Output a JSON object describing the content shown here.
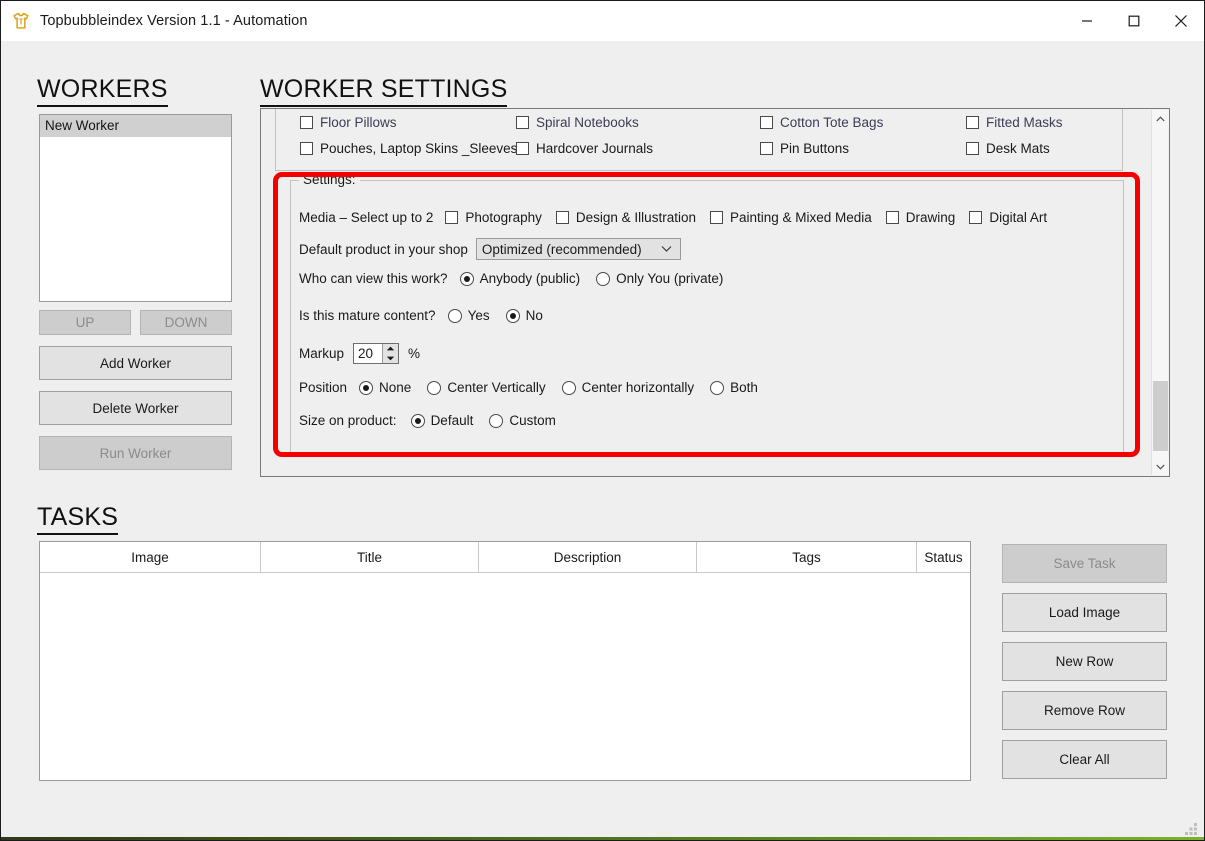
{
  "window": {
    "title": "Topbubbleindex Version 1.1 - Automation",
    "app_icon": "tshirt-icon",
    "accent_color": "#d9a520",
    "controls": {
      "minimize": "minimize-icon",
      "maximize": "maximize-icon",
      "close": "close-icon"
    }
  },
  "workers": {
    "heading": "WORKERS",
    "list": [
      {
        "label": "New Worker",
        "selected": true
      }
    ],
    "buttons": {
      "up": "UP",
      "down": "DOWN",
      "add": "Add Worker",
      "delete": "Delete Worker",
      "run": "Run Worker"
    },
    "disabled": [
      "UP",
      "DOWN",
      "Run Worker"
    ]
  },
  "worker_settings": {
    "heading": "WORKER SETTINGS",
    "products": {
      "clipped_row": [
        "Floor Pillows",
        "Spiral Notebooks",
        "Cotton Tote Bags",
        "Fitted Masks"
      ],
      "visible_row": [
        {
          "label": "Pouches, Laptop Skins _Sleeves",
          "checked": false
        },
        {
          "label": "Hardcover Journals",
          "checked": false
        },
        {
          "label": "Pin Buttons",
          "checked": false
        },
        {
          "label": "Desk Mats",
          "checked": false
        }
      ]
    },
    "settings_group": {
      "legend": "Settings:",
      "media": {
        "label": "Media – Select up to 2",
        "options": [
          {
            "label": "Photography",
            "checked": false
          },
          {
            "label": "Design & Illustration",
            "checked": false
          },
          {
            "label": "Painting & Mixed Media",
            "checked": false
          },
          {
            "label": "Drawing",
            "checked": false
          },
          {
            "label": "Digital Art",
            "checked": false
          }
        ]
      },
      "default_product": {
        "label": "Default product in your shop",
        "value": "Optimized (recommended)",
        "chevron": "chevron-down-icon"
      },
      "visibility": {
        "label": "Who can view this work?",
        "options": [
          {
            "label": "Anybody (public)",
            "checked": true
          },
          {
            "label": "Only You (private)",
            "checked": false
          }
        ]
      },
      "mature": {
        "label": "Is this mature content?",
        "options": [
          {
            "label": "Yes",
            "checked": false
          },
          {
            "label": "No",
            "checked": true
          }
        ]
      },
      "markup": {
        "label": "Markup",
        "value": "20",
        "unit": "%"
      },
      "position": {
        "label": "Position",
        "options": [
          {
            "label": "None",
            "checked": true
          },
          {
            "label": "Center Vertically",
            "checked": false
          },
          {
            "label": "Center horizontally",
            "checked": false
          },
          {
            "label": "Both",
            "checked": false
          }
        ]
      },
      "size_on_product": {
        "label": "Size on product:",
        "options": [
          {
            "label": "Default",
            "checked": true
          },
          {
            "label": "Custom",
            "checked": false
          }
        ]
      }
    },
    "scrollbar": {
      "up_arrow": "chevron-up-icon",
      "down_arrow": "chevron-down-icon"
    },
    "annotation_color": "#f50000"
  },
  "tasks": {
    "heading": "TASKS",
    "columns": [
      "Image",
      "Title",
      "Description",
      "Tags",
      "Status"
    ],
    "rows": [],
    "buttons": [
      {
        "label": "Save Task",
        "disabled": true
      },
      {
        "label": "Load Image",
        "disabled": false
      },
      {
        "label": "New Row",
        "disabled": false
      },
      {
        "label": "Remove Row",
        "disabled": false
      },
      {
        "label": "Clear All",
        "disabled": false
      }
    ]
  }
}
